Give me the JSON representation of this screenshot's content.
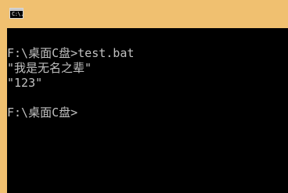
{
  "window": {
    "icon_label": "C:\\."
  },
  "console": {
    "lines": [
      "F:\\桌面C盘>test.bat",
      "\"我是无名之辈\"",
      "\"123\"",
      "",
      "F:\\桌面C盘>"
    ]
  }
}
